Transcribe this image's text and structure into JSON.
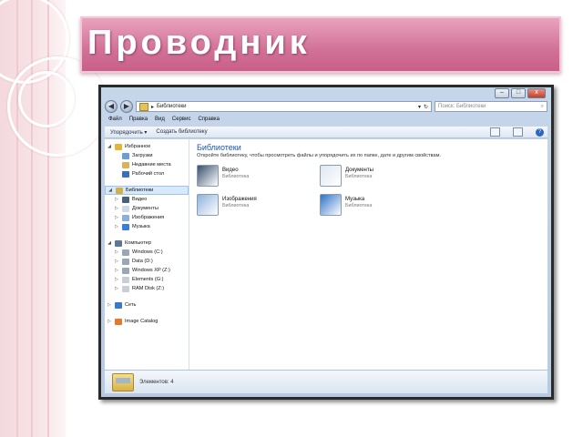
{
  "slide": {
    "title": "Проводник"
  },
  "window": {
    "controls": {
      "minimize": "–",
      "maximize": "□",
      "close": "x"
    },
    "nav": {
      "back": "◀",
      "forward": "▶"
    },
    "address": {
      "path": "Библиотеки",
      "sep": "▸"
    },
    "search": {
      "placeholder": "Поиск: Библиотеки"
    },
    "menu": [
      "Файл",
      "Правка",
      "Вид",
      "Сервис",
      "Справка"
    ],
    "toolbar": {
      "organize": "Упорядочить ▾",
      "new_library": "Создать библиотеку"
    },
    "tree": [
      {
        "label": "Избранное",
        "icon": "star-icon",
        "color": "#e3b53a",
        "level": 0,
        "expander": "◢"
      },
      {
        "label": "Загрузки",
        "icon": "downloads-folder-icon",
        "color": "#6a9fd6",
        "level": 1
      },
      {
        "label": "Недавние места",
        "icon": "recent-places-icon",
        "color": "#d9b35a",
        "level": 1
      },
      {
        "label": "Рабочий стол",
        "icon": "desktop-icon",
        "color": "#3c6fb4",
        "level": 1
      },
      {
        "label": "",
        "spacer": true
      },
      {
        "label": "Библиотеки",
        "icon": "libraries-icon",
        "color": "#d4b04b",
        "level": 0,
        "selected": true,
        "expander": "◢"
      },
      {
        "label": "Видео",
        "icon": "video-icon",
        "color": "#4a5f7a",
        "level": 1,
        "expander": "▷"
      },
      {
        "label": "Документы",
        "icon": "documents-icon",
        "color": "#cfd8e4",
        "level": 1,
        "expander": "▷"
      },
      {
        "label": "Изображения",
        "icon": "images-icon",
        "color": "#8ab0d8",
        "level": 1,
        "expander": "▷"
      },
      {
        "label": "Музыка",
        "icon": "music-icon",
        "color": "#3b7fd1",
        "level": 1,
        "expander": "▷"
      },
      {
        "label": "",
        "spacer": true
      },
      {
        "label": "Компьютер",
        "icon": "computer-icon",
        "color": "#5d7895",
        "level": 0,
        "expander": "◢"
      },
      {
        "label": "Windows (C:)",
        "icon": "drive-icon",
        "color": "#9aa7b5",
        "level": 1,
        "expander": "▷"
      },
      {
        "label": "Data (D:)",
        "icon": "drive-icon",
        "color": "#9aa7b5",
        "level": 1,
        "expander": "▷"
      },
      {
        "label": "Windows XP (Z:)",
        "icon": "drive-icon",
        "color": "#9aa7b5",
        "level": 1,
        "expander": "▷"
      },
      {
        "label": "Elements (G:)",
        "icon": "drive-icon",
        "color": "#c9ced4",
        "level": 1,
        "expander": "▷"
      },
      {
        "label": "RAM Disk (Z:)",
        "icon": "drive-icon",
        "color": "#c9ced4",
        "level": 1,
        "expander": "▷"
      },
      {
        "label": "",
        "spacer": true
      },
      {
        "label": "Сеть",
        "icon": "network-icon",
        "color": "#3a78c9",
        "level": 0,
        "expander": "▷"
      },
      {
        "label": "",
        "spacer": true
      },
      {
        "label": "Image Catalog",
        "icon": "image-catalog-icon",
        "color": "#e07a2e",
        "level": 0,
        "expander": "▷"
      }
    ],
    "main": {
      "title": "Библиотеки",
      "subtitle": "Откройте библиотеку, чтобы просмотреть файлы и упорядочить их по папке, дате и другим свойствам.",
      "libraries": [
        {
          "name": "Видео",
          "type": "Библиотека",
          "icon": "video-library-icon",
          "color": "#3a4f6e"
        },
        {
          "name": "Документы",
          "type": "Библиотека",
          "icon": "documents-library-icon",
          "color": "#dfe7f1"
        },
        {
          "name": "Изображения",
          "type": "Библиотека",
          "icon": "images-library-icon",
          "color": "#8fb3db"
        },
        {
          "name": "Музыка",
          "type": "Библиотека",
          "icon": "music-library-icon",
          "color": "#2f73c8"
        }
      ]
    },
    "details": {
      "text": "Элементов: 4"
    }
  }
}
